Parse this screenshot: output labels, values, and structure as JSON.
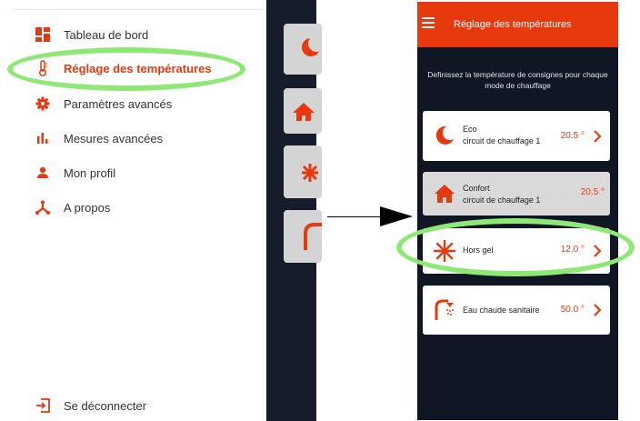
{
  "drawer": {
    "items": [
      {
        "label": "Tableau de bord",
        "icon": "dashboard-icon"
      },
      {
        "label": "Réglage des températures",
        "icon": "thermometer-icon",
        "active": true
      },
      {
        "label": "Paramètres avancés",
        "icon": "gear-icon"
      },
      {
        "label": "Mesures avancées",
        "icon": "bar-chart-icon"
      },
      {
        "label": "Mon profil",
        "icon": "user-icon"
      },
      {
        "label": "A propos",
        "icon": "share-nodes-icon"
      }
    ],
    "logout": {
      "label": "Se déconnecter",
      "icon": "logout-icon"
    }
  },
  "phone": {
    "header": {
      "title": "Réglage des températures",
      "menu_icon": "hamburger-menu-icon"
    },
    "intro": "Definissez la température de consignes pour chaque mode de chauffage",
    "modes": [
      {
        "name": "Eco",
        "subtitle": "circuit de chauffage 1",
        "temp": "20.5 °",
        "icon": "moon-icon",
        "enabled": true
      },
      {
        "name": "Confort",
        "subtitle": "circuit de chauffage 1",
        "temp": "20.5 °",
        "icon": "home-icon",
        "enabled": false
      },
      {
        "name": "Hors gel",
        "subtitle": "",
        "temp": "12.0 °",
        "icon": "snowflake-icon",
        "enabled": true
      },
      {
        "name": "Eau chaude sanitaire",
        "subtitle": "",
        "temp": "50.0 °",
        "icon": "shower-icon",
        "enabled": true
      }
    ]
  },
  "colors": {
    "accent": "#e8380d",
    "background_dark": "#101624",
    "highlight": "#8de876"
  }
}
